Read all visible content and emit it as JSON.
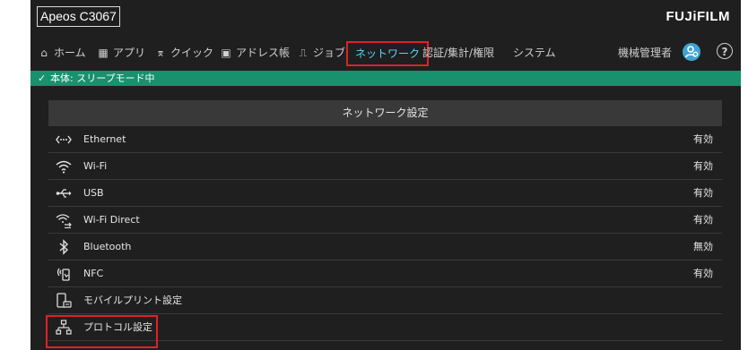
{
  "header": {
    "device_title": "Apeos C3067",
    "brand": "FUJiFILM"
  },
  "nav": {
    "items": [
      {
        "label": "ホーム",
        "icon": "home-icon",
        "glyph": "⌂"
      },
      {
        "label": "アプリ",
        "icon": "apps-icon",
        "glyph": "▦"
      },
      {
        "label": "クイック",
        "icon": "quick-icon",
        "glyph": "⌆"
      },
      {
        "label": "アドレス帳",
        "icon": "address-book-icon",
        "glyph": "▣"
      },
      {
        "label": "ジョブ",
        "icon": "job-icon",
        "glyph": "⎍"
      },
      {
        "label": "ネットワーク",
        "icon": "",
        "glyph": ""
      },
      {
        "label": "認証/集計/権限",
        "icon": "",
        "glyph": ""
      },
      {
        "label": "システム",
        "icon": "",
        "glyph": ""
      }
    ],
    "active": "ネットワーク",
    "admin_label": "機械管理者",
    "help_glyph": "?"
  },
  "status": {
    "check_glyph": "✓",
    "text": "本体: スリープモード中"
  },
  "panel": {
    "title": "ネットワーク設定",
    "rows": [
      {
        "label": "Ethernet",
        "value": "有効",
        "icon": "ethernet-icon"
      },
      {
        "label": "Wi-Fi",
        "value": "有効",
        "icon": "wifi-icon"
      },
      {
        "label": "USB",
        "value": "有効",
        "icon": "usb-icon"
      },
      {
        "label": "Wi-Fi Direct",
        "value": "有効",
        "icon": "wifi-direct-icon"
      },
      {
        "label": "Bluetooth",
        "value": "無効",
        "icon": "bluetooth-icon"
      },
      {
        "label": "NFC",
        "value": "有効",
        "icon": "nfc-icon"
      },
      {
        "label": "モバイルプリント設定",
        "value": "",
        "icon": "mobile-print-icon"
      },
      {
        "label": "プロトコル設定",
        "value": "",
        "icon": "protocol-icon"
      }
    ]
  },
  "colors": {
    "status_bar": "#17916e",
    "active_tab": "#5fd2ff",
    "highlight_border": "#e0202a",
    "background": "#1f1f1f"
  }
}
